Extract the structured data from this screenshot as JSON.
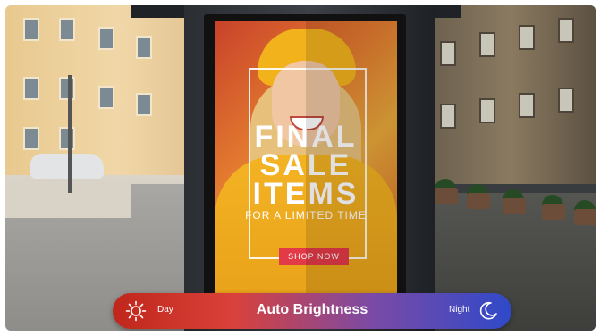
{
  "poster": {
    "line1": "FINAL",
    "line2": "SALE",
    "line3": "ITEMS",
    "line4": "FOR A LIMITED TIME",
    "button": "SHOP NOW"
  },
  "brightness_bar": {
    "title": "Auto Brightness",
    "day_label": "Day",
    "night_label": "Night",
    "left_icon": "sun-icon",
    "right_icon": "moon-icon"
  },
  "colors": {
    "accent_red": "#e23b47",
    "bar_start": "#c0261a",
    "bar_end": "#2f49c9"
  }
}
